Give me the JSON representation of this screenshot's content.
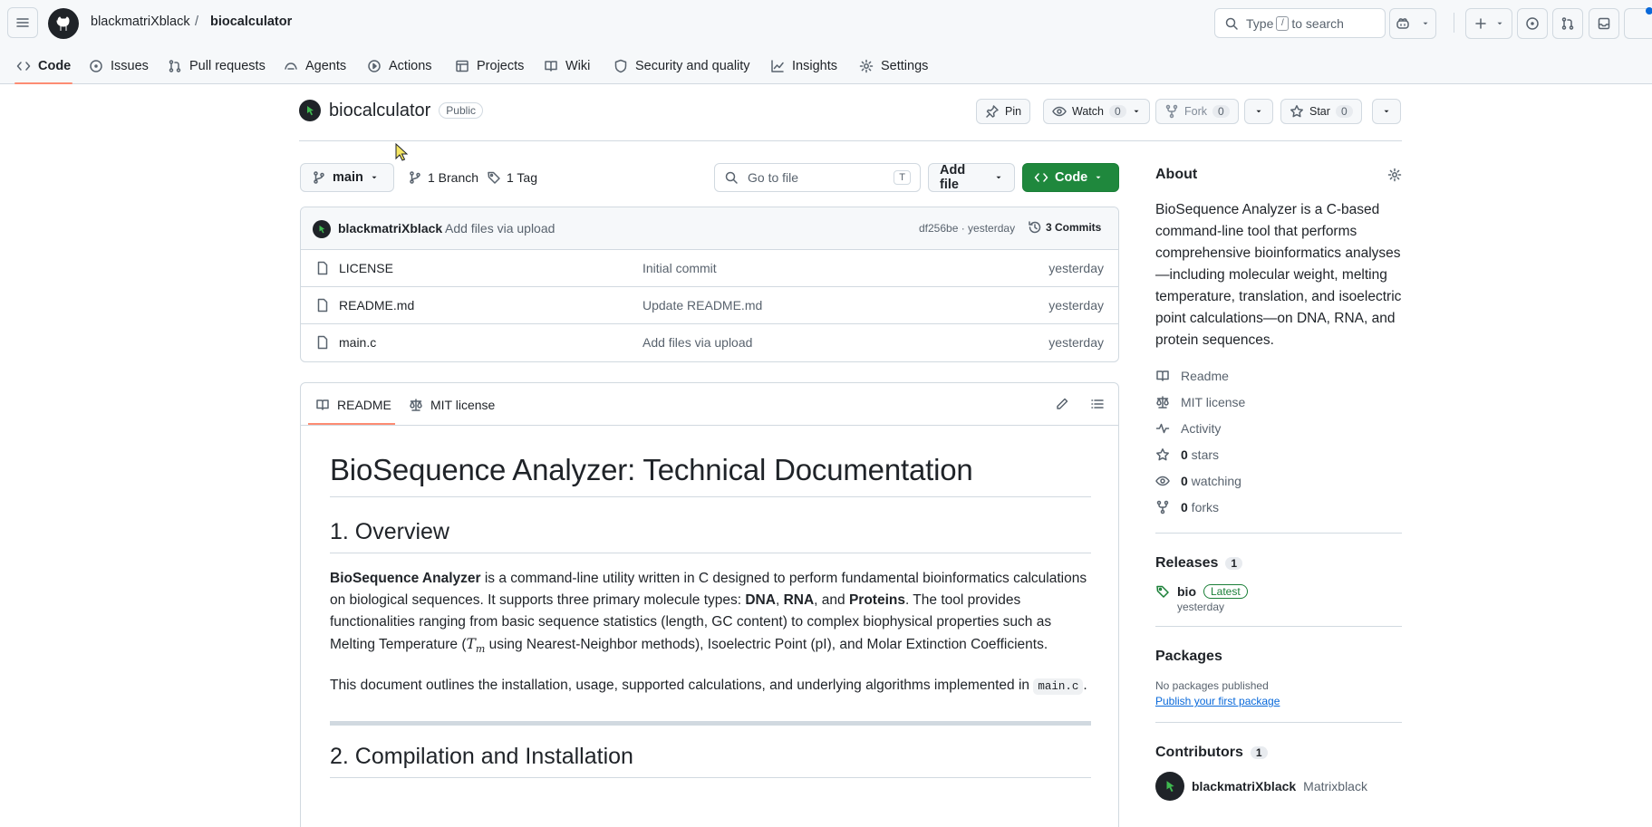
{
  "header": {
    "owner": "blackmatriXblack",
    "separator": "/",
    "repo": "biocalculator",
    "search_prefix": "Type",
    "search_key": "/",
    "search_suffix": "to search"
  },
  "tabs": [
    {
      "label": "Code",
      "icon": "code-icon"
    },
    {
      "label": "Issues",
      "icon": "issue-icon"
    },
    {
      "label": "Pull requests",
      "icon": "pull-request-icon"
    },
    {
      "label": "Agents",
      "icon": "agent-icon"
    },
    {
      "label": "Actions",
      "icon": "play-icon"
    },
    {
      "label": "Projects",
      "icon": "table-icon"
    },
    {
      "label": "Wiki",
      "icon": "book-icon"
    },
    {
      "label": "Security and quality",
      "icon": "shield-icon"
    },
    {
      "label": "Insights",
      "icon": "graph-icon"
    },
    {
      "label": "Settings",
      "icon": "gear-icon"
    }
  ],
  "repo": {
    "name": "biocalculator",
    "visibility": "Public",
    "pin_label": "Pin",
    "watch_label": "Watch",
    "watch_count": "0",
    "fork_label": "Fork",
    "fork_count": "0",
    "star_label": "Star",
    "star_count": "0"
  },
  "toolbar": {
    "branch": "main",
    "branches": "1 Branch",
    "tags": "1 Tag",
    "goto_placeholder": "Go to file",
    "goto_key": "T",
    "add_file": "Add file",
    "code": "Code"
  },
  "commit": {
    "author": "blackmatriXblack",
    "message": "Add files via upload",
    "hash_time": "df256be · yesterday",
    "commits": "3 Commits"
  },
  "files": [
    {
      "name": "LICENSE",
      "message": "Initial commit",
      "time": "yesterday"
    },
    {
      "name": "README.md",
      "message": "Update README.md",
      "time": "yesterday"
    },
    {
      "name": "main.c",
      "message": "Add files via upload",
      "time": "yesterday"
    }
  ],
  "readme_tabs": {
    "readme": "README",
    "license": "MIT license"
  },
  "readme": {
    "h1": "BioSequence Analyzer: Technical Documentation",
    "h2_overview": "1. Overview",
    "p1_b1": "BioSequence Analyzer",
    "p1_t1": " is a command-line utility written in C designed to perform fundamental bioinformatics calculations on biological sequences. It supports three primary molecule types: ",
    "p1_b2": "DNA",
    "p1_t2": ", ",
    "p1_b3": "RNA",
    "p1_t3": ", and ",
    "p1_b4": "Proteins",
    "p1_t4": ". The tool provides functionalities ranging from basic sequence statistics (length, GC content) to complex biophysical properties such as Melting Temperature (",
    "p1_math": "T",
    "p1_math_sub": "m",
    "p1_t5": " using Nearest-Neighbor methods), Isoelectric Point (pI), and Molar Extinction Coefficients.",
    "p2_t1": "This document outlines the installation, usage, supported calculations, and underlying algorithms implemented in ",
    "p2_code": "main.c",
    "p2_t2": ".",
    "h2_compile": "2. Compilation and Installation"
  },
  "about": {
    "title": "About",
    "description": "BioSequence Analyzer is a C-based command-line tool that performs comprehensive bioinformatics analyses—including molecular weight, melting temperature, translation, and isoelectric point calculations—on DNA, RNA, and protein sequences.",
    "links": [
      {
        "icon": "book-icon",
        "label": "Readme",
        "num": ""
      },
      {
        "icon": "law-icon",
        "label": "MIT license",
        "num": ""
      },
      {
        "icon": "pulse-icon",
        "label": "Activity",
        "num": ""
      },
      {
        "icon": "star-icon",
        "label": " stars",
        "num": "0"
      },
      {
        "icon": "eye-icon",
        "label": " watching",
        "num": "0"
      },
      {
        "icon": "fork-icon",
        "label": " forks",
        "num": "0"
      }
    ]
  },
  "releases": {
    "title": "Releases",
    "count": "1",
    "tag": "bio",
    "badge": "Latest",
    "time": "yesterday"
  },
  "packages": {
    "title": "Packages",
    "empty": "No packages published",
    "link": "Publish your first package"
  },
  "contributors": {
    "title": "Contributors",
    "count": "1",
    "user": "blackmatriXblack",
    "name": "Matrixblack"
  },
  "colors": {
    "accent": "#fd8c73",
    "primary_button": "#1f883d",
    "link": "#0969da",
    "latest_badge": "#1a7f37"
  }
}
